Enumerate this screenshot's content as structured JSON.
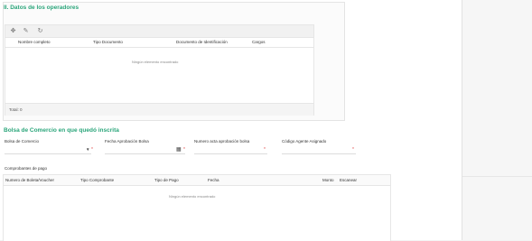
{
  "operators": {
    "title": "II. Datos de los operadores",
    "columns": [
      "Nombre completo",
      "Tipo Documento",
      "Documento de Identificación",
      "Cargos"
    ],
    "empty_message": "Ningún elemento encontrado",
    "total_label": "Total: 0",
    "toolbar_icons": [
      "move-icon",
      "edit-icon",
      "refresh-icon"
    ]
  },
  "bolsa": {
    "title": "Bolsa de Comercio en que quedó inscrita",
    "fields": [
      {
        "label": "Bolsa de Comercio",
        "value": ""
      },
      {
        "label": "Fecha Aprobación Bolsa",
        "value": ""
      },
      {
        "label": "Numero acta aprobación bolsa",
        "value": ""
      },
      {
        "label": "Código Agente Asignado",
        "value": ""
      }
    ],
    "required_mark": "*"
  },
  "comprobantes": {
    "title": "Comprobantes de pago",
    "columns": [
      "Numero de Boleta/Voucher",
      "Tipo Comprobante",
      "Tipo de Pago",
      "Fecha",
      "Monto",
      "Escanear"
    ],
    "empty_message": "Ningún elemento encontrado"
  },
  "colors": {
    "accent": "#2aa57a",
    "required": "#e04a4a"
  }
}
